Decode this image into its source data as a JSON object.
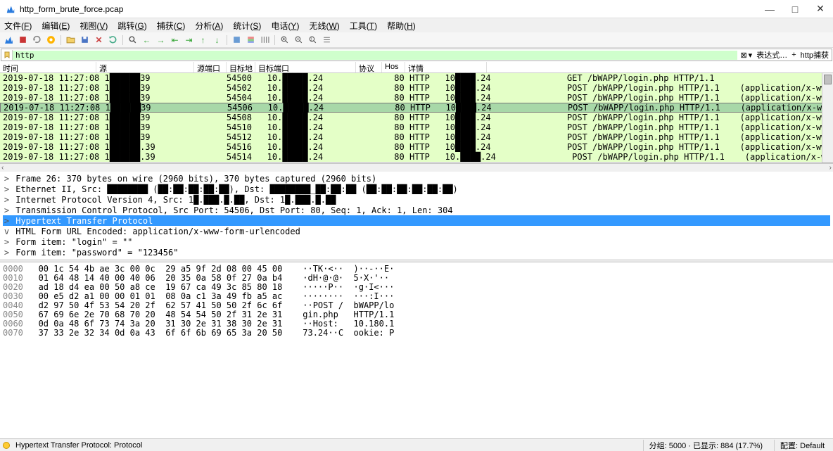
{
  "window": {
    "title": "http_form_brute_force.pcap",
    "min": "—",
    "max": "□",
    "close": "✕"
  },
  "menus": [
    "文件(F)",
    "编辑(E)",
    "视图(V)",
    "跳转(G)",
    "捕获(C)",
    "分析(A)",
    "统计(S)",
    "电话(Y)",
    "无线(W)",
    "工具(T)",
    "帮助(H)"
  ],
  "filter": {
    "value": "http",
    "expr_label": "表达式…",
    "plus": "+",
    "capture_label": "http捕获"
  },
  "columns": [
    "时间",
    "源",
    "源端口",
    "目标地",
    "目标端口",
    "协议",
    "Hos",
    "详情"
  ],
  "packets": [
    {
      "time": "2019-07-18 11:27:08",
      "src": "1",
      "srcip": "   ",
      "srcp": "39",
      "sport": "54500",
      "dst": "10.",
      "dip": "   ",
      "dsub": ".24",
      "dport": "80",
      "proto": "HTTP",
      "host": "10",
      "hmid": "   ",
      "hsub": ".24",
      "info": "GET /bWAPP/login.php HTTP/1.1",
      "extra": "",
      "sel": false
    },
    {
      "time": "2019-07-18 11:27:08",
      "src": "1",
      "srcip": "   ",
      "srcp": "39",
      "sport": "54502",
      "dst": "10.",
      "dip": "   ",
      "dsub": ".24",
      "dport": "80",
      "proto": "HTTP",
      "host": "10",
      "hmid": "   ",
      "hsub": ".24",
      "info": "POST /bWAPP/login.php HTTP/1.1",
      "extra": "(application/x-www-form-urlencoded",
      "sel": false
    },
    {
      "time": "2019-07-18 11:27:08",
      "src": "1",
      "srcip": "   ",
      "srcp": "39",
      "sport": "54504",
      "dst": "10.",
      "dip": "   ",
      "dsub": ".24",
      "dport": "80",
      "proto": "HTTP",
      "host": "10",
      "hmid": "   ",
      "hsub": ".24",
      "info": "POST /bWAPP/login.php HTTP/1.1",
      "extra": "(application/x-www-form-urlencoded",
      "sel": false
    },
    {
      "time": "2019-07-18 11:27:08",
      "src": "1",
      "srcip": "   ",
      "srcp": "39",
      "sport": "54506",
      "dst": "10.",
      "dip": "   ",
      "dsub": ".24",
      "dport": "80",
      "proto": "HTTP",
      "host": "10",
      "hmid": "   ",
      "hsub": ".24",
      "info": "POST /bWAPP/login.php HTTP/1.1",
      "extra": "(application/x-www-form-urlencoded",
      "sel": true
    },
    {
      "time": "2019-07-18 11:27:08",
      "src": "1",
      "srcip": "   ",
      "srcp": "39",
      "sport": "54508",
      "dst": "10.",
      "dip": "   ",
      "dsub": ".24",
      "dport": "80",
      "proto": "HTTP",
      "host": "10",
      "hmid": "   ",
      "hsub": ".24",
      "info": "POST /bWAPP/login.php HTTP/1.1",
      "extra": "(application/x-www-form-urlencoded",
      "sel": false
    },
    {
      "time": "2019-07-18 11:27:08",
      "src": "1",
      "srcip": "   ",
      "srcp": "39",
      "sport": "54510",
      "dst": "10.",
      "dip": "   ",
      "dsub": ".24",
      "dport": "80",
      "proto": "HTTP",
      "host": "10",
      "hmid": "   ",
      "hsub": ".24",
      "info": "POST /bWAPP/login.php HTTP/1.1",
      "extra": "(application/x-www-form-urlencoded",
      "sel": false
    },
    {
      "time": "2019-07-18 11:27:08",
      "src": "1",
      "srcip": "   ",
      "srcp": "39",
      "sport": "54512",
      "dst": "10.",
      "dip": "   ",
      "dsub": ".24",
      "dport": "80",
      "proto": "HTTP",
      "host": "10",
      "hmid": "   ",
      "hsub": ".24",
      "info": "POST /bWAPP/login.php HTTP/1.1",
      "extra": "(application/x-www-form-urlencoded",
      "sel": false
    },
    {
      "time": "2019-07-18 11:27:08",
      "src": "1",
      "srcip": "   ",
      "srcp": ".39",
      "sport": "54516",
      "dst": "10.",
      "dip": "   ",
      "dsub": ".24",
      "dport": "80",
      "proto": "HTTP",
      "host": "10",
      "hmid": "   ",
      "hsub": ".24",
      "info": "POST /bWAPP/login.php HTTP/1.1",
      "extra": "(application/x-www-form-urlencoded",
      "sel": false
    },
    {
      "time": "2019-07-18 11:27:08",
      "src": "1",
      "srcip": "   ",
      "srcp": ".39",
      "sport": "54514",
      "dst": "10.",
      "dip": "   ",
      "dsub": ".24",
      "dport": "80",
      "proto": "HTTP",
      "host": "10.",
      "hmid": "   ",
      "hsub": ".24",
      "info": "POST /bWAPP/login.php HTTP/1.1",
      "extra": "(application/x-www-form-urlencoded",
      "sel": false
    }
  ],
  "details": [
    {
      "lvl": 0,
      "exp": ">",
      "text": "Frame 26: 370 bytes on wire (2960 bits), 370 bytes captured (2960 bits)",
      "hi": false
    },
    {
      "lvl": 0,
      "exp": ">",
      "text": "Ethernet II, Src: ████████ (██:██:██:██:██), Dst: ████████_██:██:██ (██:██:██:██:██:██)",
      "hi": false
    },
    {
      "lvl": 0,
      "exp": ">",
      "text": "Internet Protocol Version 4, Src: 1█.███.█.██, Dst: 1█.███.█.██",
      "hi": false
    },
    {
      "lvl": 0,
      "exp": ">",
      "text": "Transmission Control Protocol, Src Port: 54506, Dst Port: 80, Seq: 1, Ack: 1, Len: 304",
      "hi": false
    },
    {
      "lvl": 0,
      "exp": ">",
      "text": "Hypertext Transfer Protocol",
      "hi": true
    },
    {
      "lvl": 0,
      "exp": "v",
      "text": "HTML Form URL Encoded: application/x-www-form-urlencoded",
      "hi": false
    },
    {
      "lvl": 1,
      "exp": ">",
      "text": "Form item: \"login\" = \"\"",
      "hi": false
    },
    {
      "lvl": 1,
      "exp": ">",
      "text": "Form item: \"password\" = \"123456\"",
      "hi": false
    }
  ],
  "hex": [
    {
      "off": "0000",
      "bytes": "00 1c 54 4b ae 3c 00 0c  29 a5 9f 2d 08 00 45 00",
      "ascii": " ··TK·<··  )··-··E·"
    },
    {
      "off": "0010",
      "bytes": "01 64 48 14 40 00 40 06  20 35 0a 58 0f 27 0a b4",
      "ascii": " ·dH·@·@·  5·X·'··"
    },
    {
      "off": "0020",
      "bytes": "ad 18 d4 ea 00 50 a8 ce  19 67 ca 49 3c 85 80 18",
      "ascii": " ·····P··  ·g·I<···"
    },
    {
      "off": "0030",
      "bytes": "00 e5 d2 a1 00 00 01 01  08 0a c1 3a 49 fb a5 ac",
      "ascii": " ········  ···:I···"
    },
    {
      "off": "0040",
      "bytes": "d2 97 50 4f 53 54 20 2f  62 57 41 50 50 2f 6c 6f",
      "ascii": " ··POST /  bWAPP/lo"
    },
    {
      "off": "0050",
      "bytes": "67 69 6e 2e 70 68 70 20  48 54 54 50 2f 31 2e 31",
      "ascii": " gin.php   HTTP/1.1"
    },
    {
      "off": "0060",
      "bytes": "0d 0a 48 6f 73 74 3a 20  31 30 2e 31 38 30 2e 31",
      "ascii": " ··Host:   10.180.1"
    },
    {
      "off": "0070",
      "bytes": "37 33 2e 32 34 0d 0a 43  6f 6f 6b 69 65 3a 20 50",
      "ascii": " 73.24··C  ookie: P"
    }
  ],
  "status": {
    "left": "Hypertext Transfer Protocol: Protocol",
    "pkts": "分组: 5000 · 已显示: 884 (17.7%)",
    "profile": "配置: Default"
  }
}
